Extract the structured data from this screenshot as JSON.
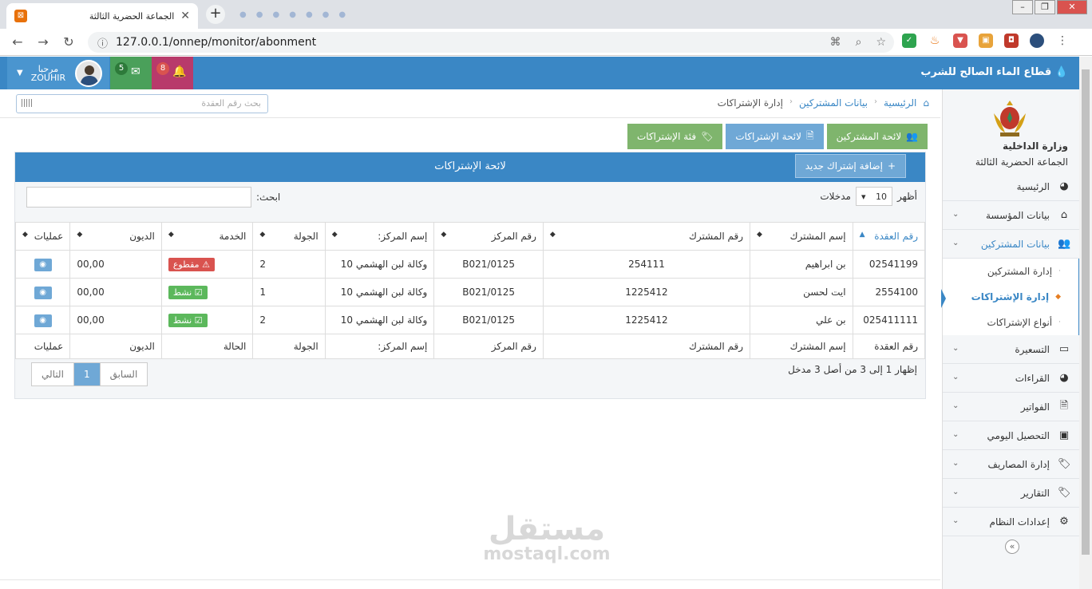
{
  "browser": {
    "tab_title": "الجماعة الحضرية الثالثة",
    "url": "127.0.0.1/onnep/monitor/abonment"
  },
  "header": {
    "brand": "قطاع الماء الصالح للشرب",
    "greeting": "مرحبا",
    "username": "ZOUHIR",
    "messages_count": "5",
    "notifications_count": "8"
  },
  "sidebar": {
    "org_line1": "وزارة الداخلية",
    "org_line2": "الجماعة الحضرية الثالثة",
    "items": [
      {
        "label": "الرئيسية"
      },
      {
        "label": "بيانات المؤسسة"
      },
      {
        "label": "بيانات المشتركين"
      },
      {
        "label": "التسعيرة"
      },
      {
        "label": "القراءات"
      },
      {
        "label": "الفواتير"
      },
      {
        "label": "التحصيل اليومي"
      },
      {
        "label": "إدارة المصاريف"
      },
      {
        "label": "التقارير"
      },
      {
        "label": "إعدادات النظام"
      }
    ],
    "subitems": [
      {
        "label": "إدارة المشتركين"
      },
      {
        "label": "إدارة الإشتراكات"
      },
      {
        "label": "أنواع الإشتراكات"
      }
    ]
  },
  "breadcrumb": {
    "home": "الرئيسية",
    "level1": "بيانات المشتركين",
    "level2": "إدارة الإشتراكات"
  },
  "search_contract_placeholder": "بحث رقم العقدة",
  "action_buttons": {
    "subscribers_list": "لائحة المشتركين",
    "subscriptions_list": "لائحة الإشتراكات",
    "subscription_category": "فئة الإشتراكات"
  },
  "panel": {
    "title": "لائحة الإشتراكات",
    "add_button": "إضافة إشتراك جديد",
    "show_label": "أظهر",
    "show_value": "10",
    "entries_label": "مدخلات",
    "search_label": "ابحث:"
  },
  "table": {
    "headers": [
      "رقم العقدة",
      "إسم المشترك",
      "رقم المشترك",
      "رقم المركز",
      "إسم المركز:",
      "الجولة",
      "الخدمة",
      "الديون",
      "عمليات"
    ],
    "footers": [
      "رقم العقدة",
      "إسم المشترك",
      "رقم المشترك",
      "رقم المركز",
      "إسم المركز:",
      "الجولة",
      "الحالة",
      "الديون",
      "عمليات"
    ],
    "rows": [
      {
        "contract": "02541199",
        "name": "بن ابراهيم",
        "sub_no": "254111",
        "center_no": "B021/0125",
        "center_name": "وكالة لبن الهشمي 10",
        "round": "2",
        "status": "مقطوع",
        "debt": "00,00"
      },
      {
        "contract": "2554100",
        "name": "ايت لحسن",
        "sub_no": "1225412",
        "center_no": "B021/0125",
        "center_name": "وكالة لبن الهشمي 10",
        "round": "1",
        "status": "نشط",
        "debt": "00,00"
      },
      {
        "contract": "025411111",
        "name": "بن علي",
        "sub_no": "1225412",
        "center_no": "B021/0125",
        "center_name": "وكالة لبن الهشمي 10",
        "round": "2",
        "status": "نشط",
        "debt": "00,00"
      }
    ]
  },
  "pagination": {
    "info": "إظهار 1 إلى 3 من أصل 3 مدخل",
    "prev": "السابق",
    "page": "1",
    "next": "التالي"
  },
  "watermark": {
    "arabic": "مستقل",
    "latin": "mostaql.com"
  }
}
